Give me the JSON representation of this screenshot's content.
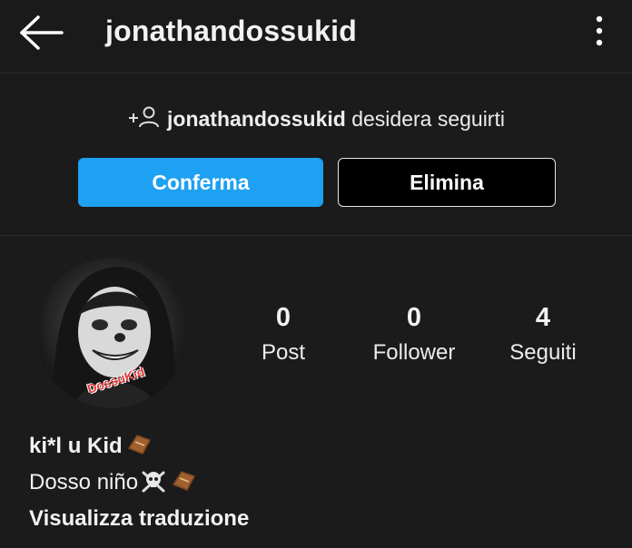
{
  "header": {
    "title": "jonathandossukid",
    "back_icon": "arrow-left-icon",
    "more_icon": "more-vertical-icon"
  },
  "follow_request": {
    "icon": "add-person-icon",
    "username": "jonathandossukid",
    "message": "desidera seguirti",
    "confirm_label": "Conferma",
    "delete_label": "Elimina"
  },
  "profile": {
    "avatar_text": "DossuKid",
    "stats": [
      {
        "value": "0",
        "label": "Post"
      },
      {
        "value": "0",
        "label": "Follower"
      },
      {
        "value": "4",
        "label": "Seguiti"
      }
    ],
    "bio": {
      "name": "ki*l u Kid",
      "line2": "Dosso niño",
      "translate_label": "Visualizza traduzione",
      "emojis": [
        "coffin-emoji",
        "skull-crossbones-emoji",
        "coffin-emoji"
      ]
    }
  },
  "colors": {
    "background": "#1b1b1b",
    "accent": "#1ea1f2",
    "text": "#f2f2f2"
  }
}
